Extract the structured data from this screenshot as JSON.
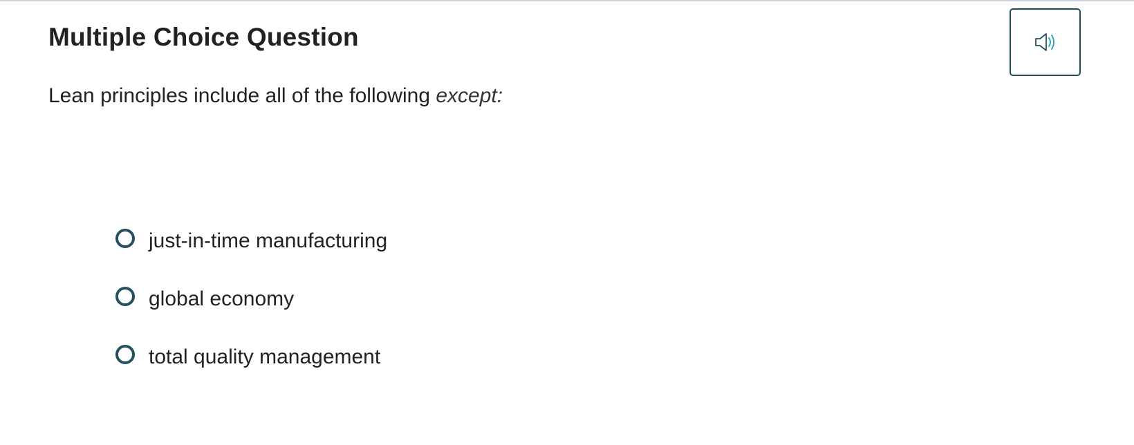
{
  "question": {
    "heading": "Multiple Choice Question",
    "prompt_text": "Lean principles include all of the following ",
    "prompt_emphasis": "except:"
  },
  "audio_button": {
    "icon": "speaker-icon",
    "aria_label": "Read aloud"
  },
  "choices": [
    {
      "label": "just-in-time manufacturing",
      "selected": false
    },
    {
      "label": "global economy",
      "selected": false
    },
    {
      "label": "total quality management",
      "selected": false
    }
  ],
  "colors": {
    "accent": "#24505f",
    "speaker_waves": "#1aa0b8",
    "text": "#222222",
    "top_rule": "#c9d3dc"
  }
}
